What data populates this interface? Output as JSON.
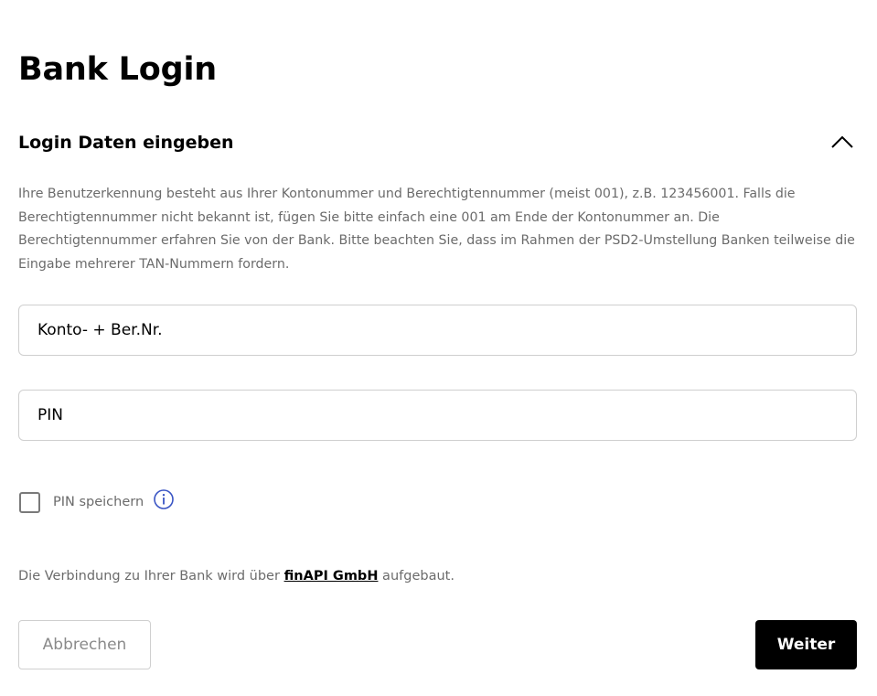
{
  "page": {
    "title": "Bank Login"
  },
  "section": {
    "title": "Login Daten eingeben",
    "toggle_icon": "chevron-up-icon",
    "help_text": "Ihre Benutzerkennung besteht aus Ihrer Kontonummer und Berechtigtennummer (meist 001), z.B. 123456001. Falls die Berechtigtennummer nicht bekannt ist, fügen Sie bitte einfach eine 001 am Ende der Kontonummer an. Die Berechtigtennummer erfahren Sie von der Bank. Bitte beachten Sie, dass im Rahmen der PSD2-Umstellung Banken teilweise die Eingabe mehrerer TAN-Nummern fordern."
  },
  "form": {
    "account_placeholder": "Konto- + Ber.Nr.",
    "account_value": "",
    "pin_placeholder": "PIN",
    "pin_value": "",
    "save_pin_label": "PIN speichern",
    "save_pin_checked": false,
    "info_icon": "info-icon"
  },
  "connection": {
    "prefix": "Die Verbindung zu Ihrer Bank wird über ",
    "provider": "finAPI GmbH",
    "suffix": " aufgebaut."
  },
  "actions": {
    "cancel_label": "Abbrechen",
    "next_label": "Weiter"
  },
  "colors": {
    "accent_info": "#3a55c4",
    "primary_button": "#000000",
    "muted_text": "#6b6b6b"
  }
}
